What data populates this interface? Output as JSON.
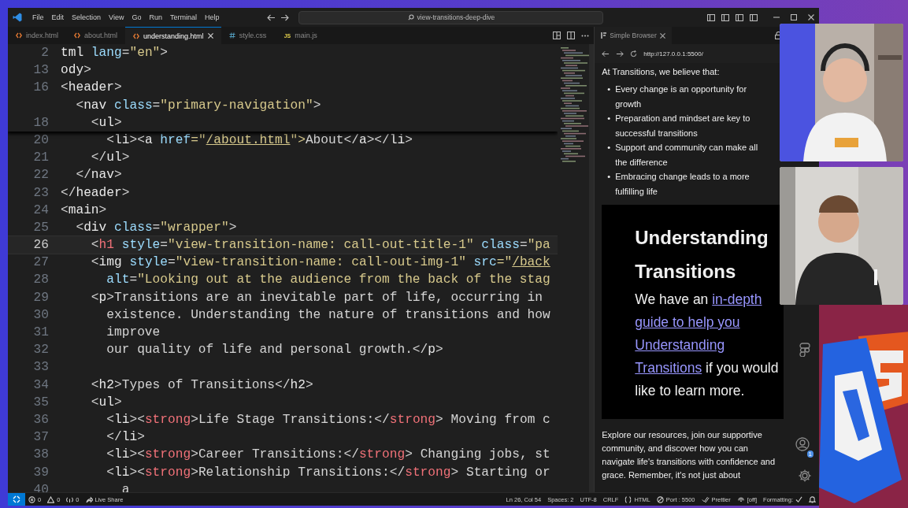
{
  "title_bar": {
    "menu": [
      "File",
      "Edit",
      "Selection",
      "View",
      "Go",
      "Run",
      "Terminal",
      "Help"
    ],
    "search": "view-transitions-deep-dive"
  },
  "editor_tabs": [
    {
      "label": "index.html",
      "kind": "html",
      "selected": false
    },
    {
      "label": "about.html",
      "kind": "html",
      "selected": false
    },
    {
      "label": "understanding.html",
      "kind": "html",
      "selected": true
    },
    {
      "label": "style.css",
      "kind": "css",
      "selected": false
    },
    {
      "label": "main.js",
      "kind": "js",
      "glyph": "JS",
      "selected": false
    }
  ],
  "sticky_lines": [
    {
      "number": "2",
      "tokens": [
        {
          "text": "tml",
          "kind": "tag"
        },
        {
          "text": " lang",
          "kind": "attr"
        },
        {
          "text": "=",
          "kind": "punct"
        },
        {
          "text": "\"en\"",
          "kind": "string"
        },
        {
          "text": ">",
          "kind": "punct"
        }
      ]
    },
    {
      "number": "13",
      "tokens": [
        {
          "text": "ody",
          "kind": "tag"
        },
        {
          "text": ">",
          "kind": "punct"
        }
      ]
    },
    {
      "number": "16",
      "tokens": [
        {
          "text": "<",
          "kind": "punct"
        },
        {
          "text": "header",
          "kind": "tag"
        },
        {
          "text": ">",
          "kind": "punct"
        }
      ]
    },
    {
      "tokens": [
        {
          "text": "  <",
          "kind": "punct"
        },
        {
          "text": "nav",
          "kind": "tag"
        },
        {
          "text": " class",
          "kind": "attr"
        },
        {
          "text": "=",
          "kind": "punct"
        },
        {
          "text": "\"primary-navigation\"",
          "kind": "string"
        },
        {
          "text": ">",
          "kind": "punct"
        }
      ]
    },
    {
      "number": "18",
      "tokens": [
        {
          "text": "    <",
          "kind": "punct"
        },
        {
          "text": "ul",
          "kind": "tag"
        },
        {
          "text": ">",
          "kind": "punct"
        }
      ]
    }
  ],
  "lines": [
    {
      "number": "20",
      "current": false,
      "tokens": [
        {
          "text": "      <",
          "kind": "punct"
        },
        {
          "text": "li",
          "kind": "tag"
        },
        {
          "text": "><",
          "kind": "punct"
        },
        {
          "text": "a",
          "kind": "tag"
        },
        {
          "text": " href",
          "kind": "attr"
        },
        {
          "text": "=\"",
          "kind": "string"
        },
        {
          "text": "/about.html",
          "kind": "link"
        },
        {
          "text": "\">",
          "kind": "string"
        },
        {
          "text": "About",
          "kind": "text"
        },
        {
          "text": "</",
          "kind": "punct"
        },
        {
          "text": "a",
          "kind": "tag"
        },
        {
          "text": "></",
          "kind": "punct"
        },
        {
          "text": "li",
          "kind": "tag"
        },
        {
          "text": ">",
          "kind": "punct"
        }
      ]
    },
    {
      "number": "21",
      "current": false,
      "tokens": [
        {
          "text": "    </",
          "kind": "punct"
        },
        {
          "text": "ul",
          "kind": "tag"
        },
        {
          "text": ">",
          "kind": "punct"
        }
      ]
    },
    {
      "number": "22",
      "current": false,
      "tokens": [
        {
          "text": "  </",
          "kind": "punct"
        },
        {
          "text": "nav",
          "kind": "tag"
        },
        {
          "text": ">",
          "kind": "punct"
        }
      ]
    },
    {
      "number": "23",
      "current": false,
      "tokens": [
        {
          "text": "</",
          "kind": "punct"
        },
        {
          "text": "header",
          "kind": "tag"
        },
        {
          "text": ">",
          "kind": "punct"
        }
      ]
    },
    {
      "number": "24",
      "current": false,
      "tokens": [
        {
          "text": "<",
          "kind": "punct"
        },
        {
          "text": "main",
          "kind": "tag"
        },
        {
          "text": ">",
          "kind": "punct"
        }
      ]
    },
    {
      "number": "25",
      "current": false,
      "tokens": [
        {
          "text": "  <",
          "kind": "punct"
        },
        {
          "text": "div",
          "kind": "tag"
        },
        {
          "text": " class",
          "kind": "attr"
        },
        {
          "text": "=",
          "kind": "punct"
        },
        {
          "text": "\"wrapper\"",
          "kind": "string"
        },
        {
          "text": ">",
          "kind": "punct"
        }
      ]
    },
    {
      "number": "26",
      "current": true,
      "tokens": [
        {
          "text": "    <",
          "kind": "punct"
        },
        {
          "text": "h1",
          "kind": "strong"
        },
        {
          "text": " style",
          "kind": "attr"
        },
        {
          "text": "=",
          "kind": "punct"
        },
        {
          "text": "\"view-transition-name: call-out-title-1\"",
          "kind": "string"
        },
        {
          "text": " class",
          "kind": "attr"
        },
        {
          "text": "=",
          "kind": "punct"
        },
        {
          "text": "\"pa",
          "kind": "string"
        }
      ]
    },
    {
      "number": "27",
      "current": false,
      "tokens": [
        {
          "text": "    <",
          "kind": "punct"
        },
        {
          "text": "img",
          "kind": "tag"
        },
        {
          "text": " style",
          "kind": "attr"
        },
        {
          "text": "=",
          "kind": "punct"
        },
        {
          "text": "\"view-transition-name: call-out-img-1\"",
          "kind": "string"
        },
        {
          "text": " src",
          "kind": "attr"
        },
        {
          "text": "=\"",
          "kind": "string"
        },
        {
          "text": "/back",
          "kind": "link"
        }
      ]
    },
    {
      "number": "28",
      "current": false,
      "tokens": [
        {
          "text": "      alt",
          "kind": "attr"
        },
        {
          "text": "=",
          "kind": "punct"
        },
        {
          "text": "\"Looking out at the audience from the back of the stag",
          "kind": "string"
        }
      ]
    },
    {
      "number": "29",
      "current": false,
      "tokens": [
        {
          "text": "    <",
          "kind": "punct"
        },
        {
          "text": "p",
          "kind": "tag"
        },
        {
          "text": ">",
          "kind": "punct"
        },
        {
          "text": "Transitions are an inevitable part of life, occurring in",
          "kind": "text"
        }
      ]
    },
    {
      "number": "30",
      "current": false,
      "tokens": [
        {
          "text": "      existence. Understanding the nature of transitions and how",
          "kind": "text"
        }
      ]
    },
    {
      "number": "31",
      "current": false,
      "tokens": [
        {
          "text": "      improve",
          "kind": "text"
        }
      ]
    },
    {
      "number": "32",
      "current": false,
      "tokens": [
        {
          "text": "      our quality of life and personal growth.",
          "kind": "text"
        },
        {
          "text": "</",
          "kind": "punct"
        },
        {
          "text": "p",
          "kind": "tag"
        },
        {
          "text": ">",
          "kind": "punct"
        }
      ]
    },
    {
      "number": "33",
      "current": false
    },
    {
      "number": "34",
      "current": false,
      "tokens": [
        {
          "text": "    <",
          "kind": "punct"
        },
        {
          "text": "h2",
          "kind": "tag"
        },
        {
          "text": ">",
          "kind": "punct"
        },
        {
          "text": "Types of Transitions",
          "kind": "text"
        },
        {
          "text": "</",
          "kind": "punct"
        },
        {
          "text": "h2",
          "kind": "tag"
        },
        {
          "text": ">",
          "kind": "punct"
        }
      ]
    },
    {
      "number": "35",
      "current": false,
      "tokens": [
        {
          "text": "    <",
          "kind": "punct"
        },
        {
          "text": "ul",
          "kind": "tag"
        },
        {
          "text": ">",
          "kind": "punct"
        }
      ]
    },
    {
      "number": "36",
      "current": false,
      "tokens": [
        {
          "text": "      <",
          "kind": "punct"
        },
        {
          "text": "li",
          "kind": "tag"
        },
        {
          "text": "><",
          "kind": "punct"
        },
        {
          "text": "strong",
          "kind": "strong"
        },
        {
          "text": ">",
          "kind": "punct"
        },
        {
          "text": "Life Stage Transitions:",
          "kind": "text"
        },
        {
          "text": "</",
          "kind": "punct"
        },
        {
          "text": "strong",
          "kind": "strong"
        },
        {
          "text": ">",
          "kind": "punct"
        },
        {
          "text": " Moving from c",
          "kind": "text"
        }
      ]
    },
    {
      "number": "37",
      "current": false,
      "tokens": [
        {
          "text": "      </",
          "kind": "punct"
        },
        {
          "text": "li",
          "kind": "tag"
        },
        {
          "text": ">",
          "kind": "punct"
        }
      ]
    },
    {
      "number": "38",
      "current": false,
      "tokens": [
        {
          "text": "      <",
          "kind": "punct"
        },
        {
          "text": "li",
          "kind": "tag"
        },
        {
          "text": "><",
          "kind": "punct"
        },
        {
          "text": "strong",
          "kind": "strong"
        },
        {
          "text": ">",
          "kind": "punct"
        },
        {
          "text": "Career Transitions:",
          "kind": "text"
        },
        {
          "text": "</",
          "kind": "punct"
        },
        {
          "text": "strong",
          "kind": "strong"
        },
        {
          "text": ">",
          "kind": "punct"
        },
        {
          "text": " Changing jobs, st",
          "kind": "text"
        }
      ]
    },
    {
      "number": "39",
      "current": false,
      "tokens": [
        {
          "text": "      <",
          "kind": "punct"
        },
        {
          "text": "li",
          "kind": "tag"
        },
        {
          "text": "><",
          "kind": "punct"
        },
        {
          "text": "strong",
          "kind": "strong"
        },
        {
          "text": ">",
          "kind": "punct"
        },
        {
          "text": "Relationship Transitions:",
          "kind": "text"
        },
        {
          "text": "</",
          "kind": "punct"
        },
        {
          "text": "strong",
          "kind": "strong"
        },
        {
          "text": ">",
          "kind": "punct"
        },
        {
          "text": " Starting or",
          "kind": "text"
        }
      ]
    },
    {
      "number": "40",
      "current": false,
      "tokens": [
        {
          "text": "        a",
          "kind": "text"
        }
      ]
    }
  ],
  "browser": {
    "tab": "Simple Browser",
    "url": "http://127.0.0.1:5500/",
    "intro": "At Transitions, we believe that:",
    "bullets": [
      "Every change is an opportunity for growth",
      "Preparation and mindset are key to successful transitions",
      "Support and community can make all the difference",
      "Embracing change leads to a more fulfilling life"
    ],
    "bullet_marker": "•",
    "hero": {
      "heading": "Understanding Transitions",
      "parts": [
        {
          "text": "We have an ",
          "kind": "text"
        },
        {
          "text": "in-depth",
          "kind": "link"
        },
        {
          "text": "guide to help you",
          "kind": "link"
        },
        {
          "text": "Understanding",
          "kind": "link"
        },
        {
          "text": "Transitions",
          "kind": "link"
        },
        {
          "text": " if you would like to learn more.",
          "kind": "text"
        }
      ]
    },
    "outro": "Explore our resources, join our supportive community, and discover how you can navigate life's transitions with confidence and grace. Remember, it's not just about"
  },
  "activity_bar": [
    {
      "kind": "figma"
    },
    {
      "kind": "accounts",
      "badge": "1"
    },
    {
      "kind": "settings"
    }
  ],
  "status_bar": {
    "left": [
      {
        "kind": "remote"
      },
      {
        "kind": "errors",
        "text": "0"
      },
      {
        "kind": "warnings",
        "text": "0"
      },
      {
        "kind": "ports",
        "text": "0"
      },
      {
        "kind": "liveshare",
        "text": "Live Share"
      }
    ],
    "right": [
      {
        "kind": "plain",
        "text": "Ln 26, Col 54"
      },
      {
        "kind": "plain",
        "text": "Spaces: 2"
      },
      {
        "kind": "plain",
        "text": "UTF-8"
      },
      {
        "kind": "plain",
        "text": "CRLF"
      },
      {
        "kind": "braces",
        "text": "HTML"
      },
      {
        "kind": "port",
        "text": "Port : 5500"
      },
      {
        "kind": "checks",
        "text": "Prettier"
      },
      {
        "kind": "broadcast",
        "text": "[off]"
      },
      {
        "kind": "check-after",
        "text": "Formatting:"
      },
      {
        "kind": "bell"
      }
    ]
  }
}
